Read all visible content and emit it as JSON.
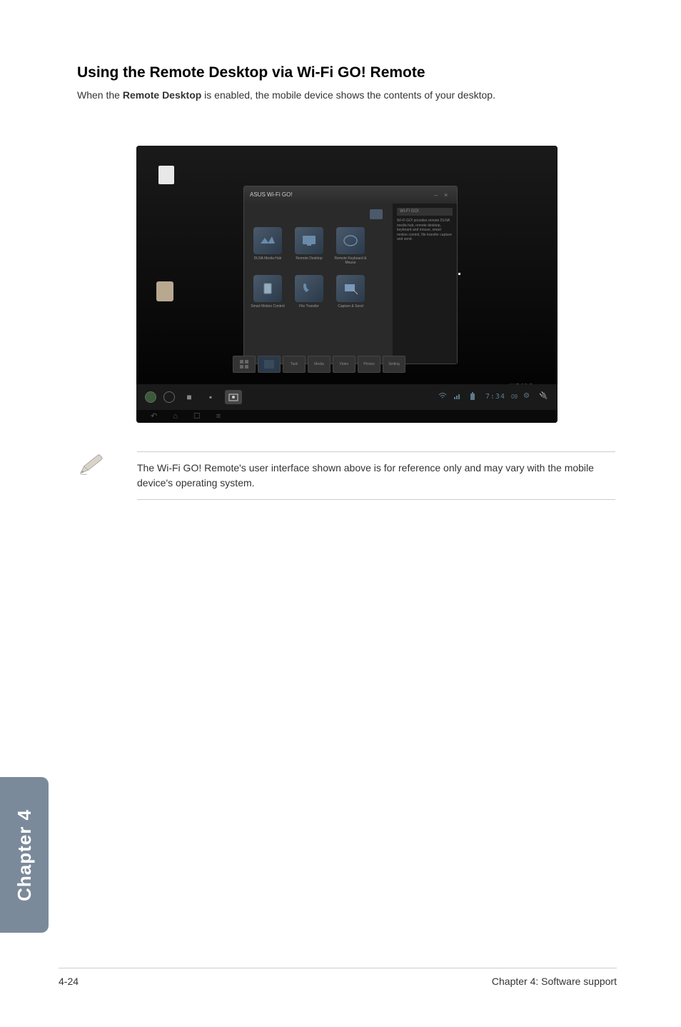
{
  "heading": "Using the Remote Desktop via Wi-Fi GO! Remote",
  "intro_prefix": "When the ",
  "intro_bold": "Remote Desktop",
  "intro_suffix": " is enabled, the mobile device shows the contents of your desktop.",
  "screenshot": {
    "wifi_window_title": "ASUS Wi-Fi GO!",
    "sidebar_header": "Wi-Fi GO!",
    "icons_row1": [
      {
        "label": "DLNA Media Hub"
      },
      {
        "label": "Remote Desktop"
      },
      {
        "label": "Remote Keyboard & Mouse"
      }
    ],
    "icons_row2": [
      {
        "label": "Smart Motion Control"
      },
      {
        "label": "File Transfer"
      },
      {
        "label": "Capture & Send"
      }
    ],
    "taskbar_items": [
      "Task",
      "Media",
      "Video",
      "Photos",
      "Setting"
    ],
    "remote_label": "Wi-Fi GO! Remote",
    "nav_time": "7:34",
    "nav_battery": "09"
  },
  "note_text": "The Wi-Fi GO! Remote's user interface shown above is for reference only and may vary with the mobile device's operating system.",
  "side_tab": "Chapter 4",
  "footer": {
    "page": "4-24",
    "chapter": "Chapter 4: Software support"
  }
}
